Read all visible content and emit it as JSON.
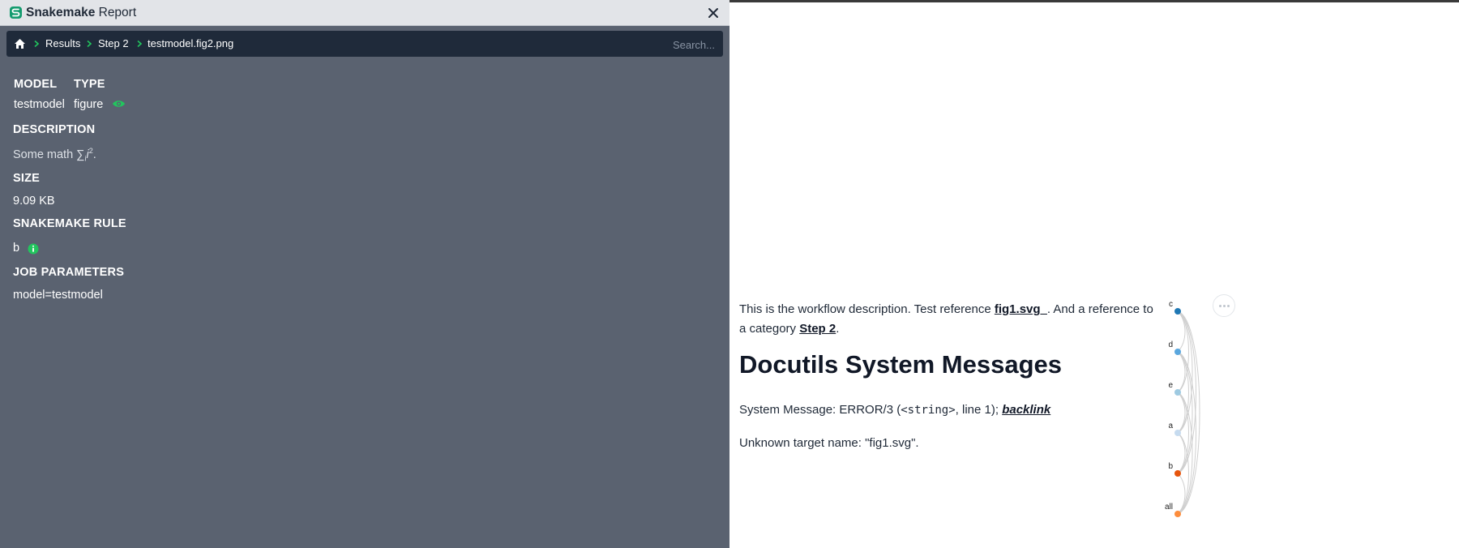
{
  "app": {
    "title_bold": "Snakemake",
    "title_rest": " Report"
  },
  "breadcrumb": {
    "items": [
      "Results",
      "Step 2",
      "testmodel.fig2.png"
    ],
    "search_placeholder": "Search..."
  },
  "details": {
    "model_label": "MODEL",
    "model_value": "testmodel",
    "type_label": "TYPE",
    "type_value": "figure",
    "description_label": "DESCRIPTION",
    "description_prefix": "Some math ",
    "description_math": "∑",
    "description_sub": "i",
    "description_var": "i",
    "description_sup": "2",
    "description_suffix": ".",
    "size_label": "SIZE",
    "size_value": "9.09 KB",
    "rule_label": "SNAKEMAKE RULE",
    "rule_value": "b",
    "params_label": "JOB PARAMETERS",
    "params_value": "model=testmodel"
  },
  "content": {
    "desc_1": "This is the workflow description. Test reference ",
    "desc_link1": "fig1.svg_",
    "desc_2": ". And a reference to a category ",
    "desc_link2": "Step 2",
    "desc_3": ".",
    "heading": "Docutils System Messages",
    "sysmsg_1": "System Message: ERROR/3 (",
    "sysmsg_code": "<string>",
    "sysmsg_2": ", line 1); ",
    "sysmsg_link": "backlink",
    "unknown": "Unknown target name: \"fig1.svg\"."
  },
  "graph": {
    "nodes": [
      {
        "label": "c",
        "color": "#1f78b4"
      },
      {
        "label": "d",
        "color": "#5aa7de"
      },
      {
        "label": "e",
        "color": "#9ecae1"
      },
      {
        "label": "a",
        "color": "#c6dbef"
      },
      {
        "label": "b",
        "color": "#e6550d"
      },
      {
        "label": "all",
        "color": "#fd8d3c"
      }
    ]
  },
  "colors": {
    "accent": "#22c55e",
    "panel": "#5a6270",
    "breadcrumb_bg": "#1f2a3a"
  }
}
